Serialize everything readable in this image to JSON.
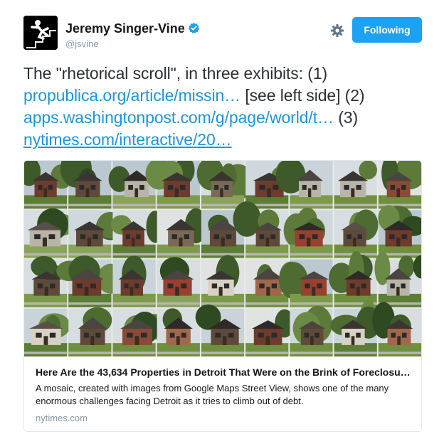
{
  "user": {
    "name": "Jeremy Singer-Vine",
    "handle": "@jsvine",
    "verified": true
  },
  "follow_button": {
    "label": "Following"
  },
  "tweet": {
    "text_part1": "The \"rhetorical scroll\", in three exhibits: (1) ",
    "link1": "propublica.org/article/missin…",
    "text_part2": " [see left side] (2) ",
    "link2": "apps.washingtonpost.com/g/page/world/t…",
    "text_part3": " (3) ",
    "link3": "nytimes.com/interactive/20…"
  },
  "card": {
    "title": "Here Are the 43,634 Properties in Detroit That Were on the Brink of Foreclosu…",
    "description": "A mosaic, created with images from Google Maps Street View, shows one of the many enormous challenges facing Detroit as it tries to climb out of debt.",
    "domain": "nytimes.com",
    "mosaic_rows": 4,
    "mosaic_cols": 9
  },
  "colors": {
    "accent": "#1da1f2",
    "link": "#1b95e0",
    "secondary_text": "#8899a6",
    "border": "#e1e8ed"
  },
  "icons": [
    "verified-badge-icon",
    "gear-icon",
    "avatar-figure-icon"
  ]
}
